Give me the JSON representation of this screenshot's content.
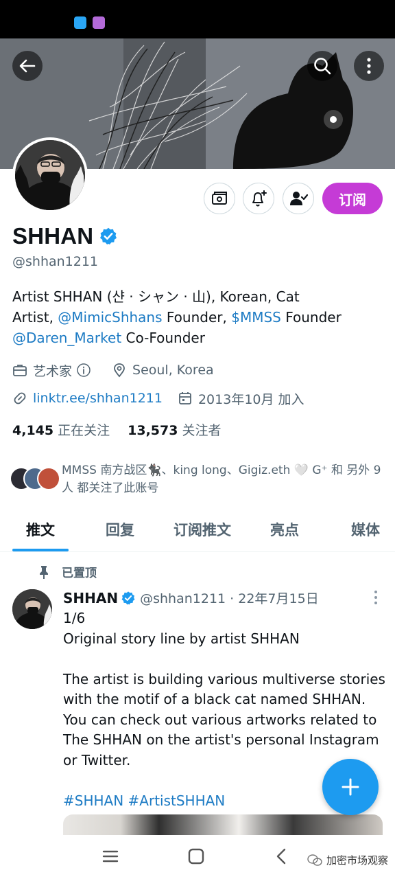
{
  "profile": {
    "display_name": "SHHAN",
    "handle": "@shhan1211",
    "subscribe_label": "订阅",
    "bio": {
      "line1": "Artist SHHAN (샨 · シャン · 山), Korean, Cat",
      "line2_prefix": "Artist, ",
      "line2_link1": "@MimicShhans",
      "line2_mid": " Founder, ",
      "line2_link2": "$MMSS",
      "line2_suffix": " Founder",
      "line3_link": "@Daren_Market",
      "line3_suffix": " Co-Founder"
    },
    "category": "艺术家",
    "location": "Seoul, Korea",
    "website": "linktr.ee/shhan1211",
    "joined": "2013年10月 加入",
    "following_count": "4,145",
    "following_label": "正在关注",
    "followers_count": "13,573",
    "followers_label": "关注者",
    "known_followers_text": "MMSS 南方战区🐈‍⬛、king long、Gigiz.eth 🤍 G⁺ 和 另外 9 人 都关注了此账号"
  },
  "tabs": [
    "推文",
    "回复",
    "订阅推文",
    "亮点",
    "媒体"
  ],
  "pinned_label": "已置顶",
  "post": {
    "name": "SHHAN",
    "meta": "@shhan1211 · 22年7月15日",
    "line1": "1/6",
    "line2": "Original story line by artist SHHAN",
    "paragraph": "The artist is building various multiverse stories with the motif of a black cat named SHHAN. You can check out various artworks related to The SHHAN on the artist's personal Instagram or Twitter.",
    "hashtags": "#SHHAN #ArtistSHHAN"
  },
  "watermark": "加密市场观察",
  "colors": {
    "accent": "#1d9bf0",
    "subscribe": "#c53bd6",
    "link": "#1d7bc4",
    "muted": "#536471"
  },
  "icons": [
    "back-arrow-icon",
    "search-icon",
    "more-vertical-icon",
    "ticket-icon",
    "bell-plus-icon",
    "person-check-icon",
    "verified-badge-icon",
    "briefcase-icon",
    "info-icon",
    "location-pin-icon",
    "link-icon",
    "calendar-icon",
    "pin-icon",
    "plus-icon",
    "recent-apps-icon",
    "home-icon",
    "back-nav-icon",
    "wechat-icon"
  ]
}
